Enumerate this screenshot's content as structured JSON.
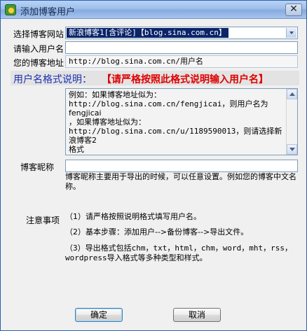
{
  "window": {
    "title": "添加博客用户",
    "close_label": "✕"
  },
  "form": {
    "site_label": "选择博客网站",
    "site_value": "新浪博客1[含评论]【blog.sina.com.cn】",
    "username_label": "请输入用户名",
    "username_value": "",
    "address_label": "您的博客地址",
    "address_value": "http://blog.sina.com.cn/用户名"
  },
  "format": {
    "title": "用户名格式说明：",
    "note": "【请严格按照此格式说明输入用户名】",
    "example": {
      "line1": "例如：如果博客地址似为：",
      "line2a": "http://blog.sina.com.cn/fengjicai",
      "line2b": "，则用户名为fengjicai",
      "line3": "，如果博客地址似为：",
      "line4a": "http://blog.sina.com.cn/u/1189590013",
      "line4b": "，则请选择新浪博客2",
      "line5": "格式"
    }
  },
  "nickname": {
    "label": "博客昵称",
    "value": "",
    "desc": "博客昵称主要用于导出的时候，可以任意设置。例如您的博客中文名称。"
  },
  "notes": {
    "label": "注意事项",
    "items": [
      "（1）请严格按照说明格式填写用户名。",
      "（2）基本步骤：添加用户-->备份博客-->导出文件。",
      "（3）导出格式包括chm，txt，html，chm，word，mht，rss，wordpress导入格式等多种类型和样式。"
    ]
  },
  "buttons": {
    "ok": "确定",
    "cancel": "取消"
  }
}
